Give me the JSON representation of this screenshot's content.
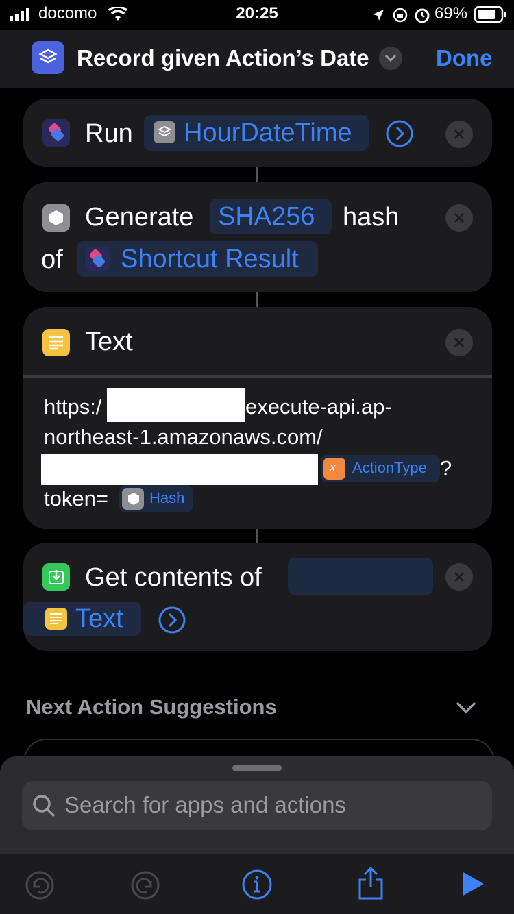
{
  "status_bar": {
    "carrier": "docomo",
    "time": "20:25",
    "battery": "69%"
  },
  "nav": {
    "title": "Record given Action’s Date",
    "done_label": "Done"
  },
  "actions": {
    "run": {
      "verb": "Run",
      "shortcut_name": "HourDateTime"
    },
    "hash": {
      "verb": "Generate",
      "algorithm": "SHA256",
      "word_hash": "hash",
      "word_of": "of",
      "input": "Shortcut Result"
    },
    "text": {
      "title": "Text",
      "line1_prefix": "https:/",
      "line1_suffix": "execute-api.ap-",
      "line2": "northeast-1.amazonaws.com/",
      "var_action_type": "ActionType",
      "question": "?",
      "token_label": "token=",
      "var_hash": "Hash"
    },
    "get_contents": {
      "verb": "Get contents of",
      "input": "Text"
    }
  },
  "suggestions": {
    "heading": "Next Action Suggestions"
  },
  "search": {
    "placeholder": "Search for apps and actions"
  },
  "colors": {
    "accent": "#3b82f6",
    "card_bg": "#1c1c1e",
    "variable_orange": "#f0883e",
    "text_yellow": "#f5c342",
    "get_green": "#34c759"
  }
}
